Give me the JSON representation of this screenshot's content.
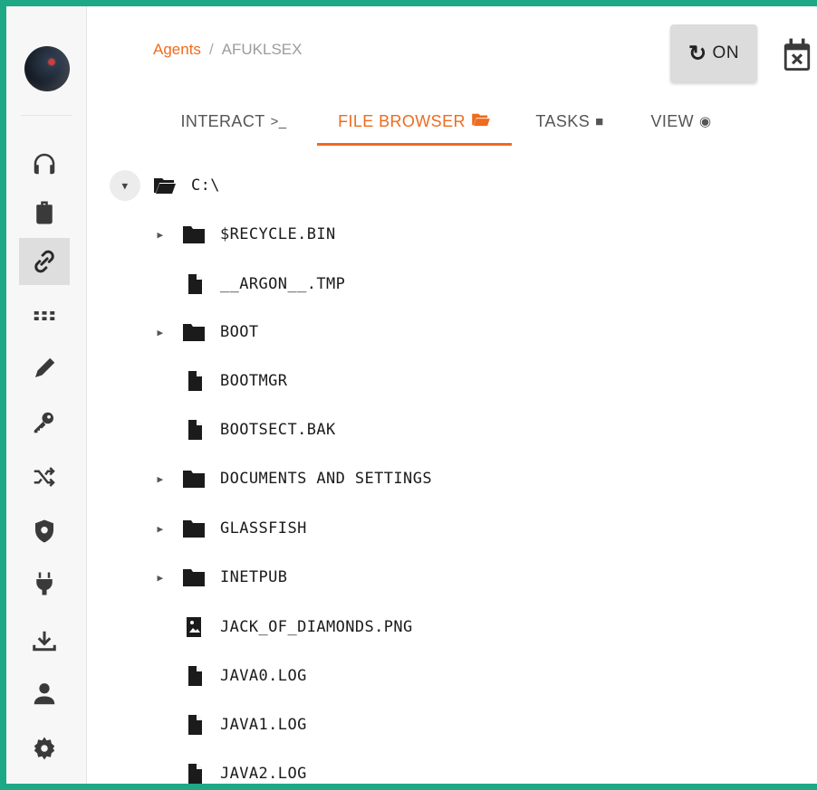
{
  "breadcrumb": {
    "root": "Agents",
    "separator": "/",
    "current": "AFUKLSEX"
  },
  "header": {
    "refresh_label": "ON",
    "refresh_glyph": "↻"
  },
  "tabs": [
    {
      "label": "INTERACT",
      "glyph": ">_"
    },
    {
      "label": "FILE BROWSER",
      "glyph": "▶"
    },
    {
      "label": "TASKS",
      "glyph": "■"
    },
    {
      "label": "VIEW",
      "glyph": "◉"
    }
  ],
  "sidebar": {
    "icons": [
      "headphones-icon",
      "briefcase-icon",
      "link-icon",
      "apps-grid-icon",
      "pencil-icon",
      "key-icon",
      "shuffle-icon",
      "shield-icon",
      "plug-icon",
      "download-icon",
      "user-icon",
      "gear-icon"
    ]
  },
  "tree": {
    "root": {
      "name": "C:\\",
      "icon": "folder-open-icon"
    },
    "items": [
      {
        "name": "$RECYCLE.BIN",
        "type": "folder"
      },
      {
        "name": "__ARGON__.TMP",
        "type": "file"
      },
      {
        "name": "BOOT",
        "type": "folder"
      },
      {
        "name": "BOOTMGR",
        "type": "file"
      },
      {
        "name": "BOOTSECT.BAK",
        "type": "file"
      },
      {
        "name": "DOCUMENTS AND SETTINGS",
        "type": "folder"
      },
      {
        "name": "GLASSFISH",
        "type": "folder"
      },
      {
        "name": "INETPUB",
        "type": "folder"
      },
      {
        "name": "JACK_OF_DIAMONDS.PNG",
        "type": "image"
      },
      {
        "name": "JAVA0.LOG",
        "type": "file"
      },
      {
        "name": "JAVA1.LOG",
        "type": "file"
      },
      {
        "name": "JAVA2.LOG",
        "type": "file"
      }
    ]
  },
  "colors": {
    "accent": "#ee6b1f",
    "frame": "#1fa886"
  }
}
